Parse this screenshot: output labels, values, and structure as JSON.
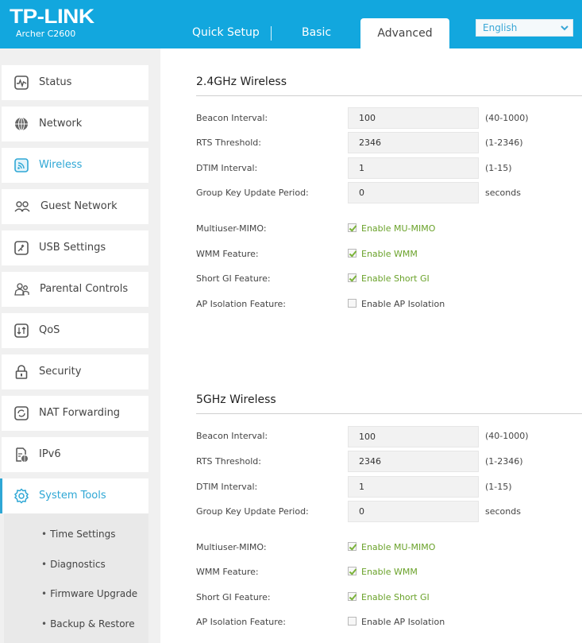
{
  "header": {
    "brand": "TP-LINK",
    "model": "Archer C2600",
    "tabs": [
      {
        "label": "Quick Setup",
        "active": false
      },
      {
        "label": "Basic",
        "active": false
      },
      {
        "label": "Advanced",
        "active": true
      }
    ],
    "language": {
      "selected": "English",
      "icon": "chevron-down-icon"
    }
  },
  "sidebar": {
    "items": [
      {
        "label": "Status",
        "icon": "status-pulse-icon"
      },
      {
        "label": "Network",
        "icon": "globe-icon"
      },
      {
        "label": "Wireless",
        "icon": "wireless-icon",
        "active": true
      },
      {
        "label": "Guest Network",
        "icon": "guest-users-icon"
      },
      {
        "label": "USB Settings",
        "icon": "usb-icon"
      },
      {
        "label": "Parental Controls",
        "icon": "parental-icon"
      },
      {
        "label": "QoS",
        "icon": "qos-arrows-icon"
      },
      {
        "label": "Security",
        "icon": "lock-icon"
      },
      {
        "label": "NAT Forwarding",
        "icon": "nat-refresh-icon"
      },
      {
        "label": "IPv6",
        "icon": "ipv6-doc-icon"
      },
      {
        "label": "System Tools",
        "icon": "gear-icon",
        "expanded": true
      }
    ],
    "submenu": [
      {
        "label": "Time Settings"
      },
      {
        "label": "Diagnostics"
      },
      {
        "label": "Firmware Upgrade"
      },
      {
        "label": "Backup & Restore"
      }
    ]
  },
  "accent_color": "#12a7de",
  "check_color": "#6aa22a",
  "sections": [
    {
      "title": "2.4GHz Wireless",
      "fields": [
        {
          "label": "Beacon Interval:",
          "value": "100",
          "hint": "(40-1000)"
        },
        {
          "label": "RTS Threshold:",
          "value": "2346",
          "hint": "(1-2346)"
        },
        {
          "label": "DTIM Interval:",
          "value": "1",
          "hint": "(1-15)"
        },
        {
          "label": "Group Key Update Period:",
          "value": "0",
          "hint": "seconds"
        }
      ],
      "checks": [
        {
          "label": "Multiuser-MIMO:",
          "option": "Enable MU-MIMO",
          "checked": true
        },
        {
          "label": "WMM Feature:",
          "option": "Enable WMM",
          "checked": true
        },
        {
          "label": "Short GI Feature:",
          "option": "Enable Short GI",
          "checked": true
        },
        {
          "label": "AP Isolation Feature:",
          "option": "Enable AP Isolation",
          "checked": false
        }
      ]
    },
    {
      "title": "5GHz Wireless",
      "fields": [
        {
          "label": "Beacon Interval:",
          "value": "100",
          "hint": "(40-1000)"
        },
        {
          "label": "RTS Threshold:",
          "value": "2346",
          "hint": "(1-2346)"
        },
        {
          "label": "DTIM Interval:",
          "value": "1",
          "hint": "(1-15)"
        },
        {
          "label": "Group Key Update Period:",
          "value": "0",
          "hint": "seconds"
        }
      ],
      "checks": [
        {
          "label": "Multiuser-MIMO:",
          "option": "Enable MU-MIMO",
          "checked": true
        },
        {
          "label": "WMM Feature:",
          "option": "Enable WMM",
          "checked": true
        },
        {
          "label": "Short GI Feature:",
          "option": "Enable Short GI",
          "checked": true
        },
        {
          "label": "AP Isolation Feature:",
          "option": "Enable AP Isolation",
          "checked": false
        }
      ]
    }
  ]
}
